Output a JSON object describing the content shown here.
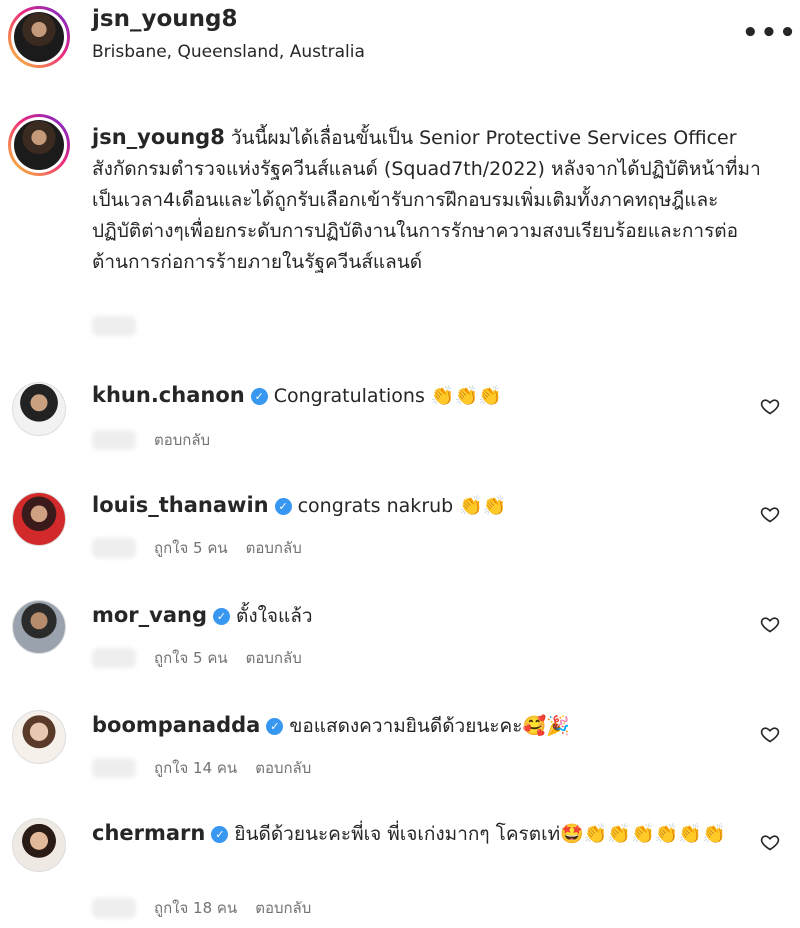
{
  "post_header": {
    "username": "jsn_young8",
    "location": "Brisbane, Queensland, Australia",
    "more_icon": "more-horizontal-icon"
  },
  "caption": {
    "username": "jsn_young8",
    "text": "วันนี้ผมได้เลื่อนขั้นเป็น Senior Protective Services Officer สังกัดกรมตำรวจแห่งรัฐควีนส์แลนด์ (Squad7th/2022) หลังจากได้ปฏิบัติหน้าที่มาเป็นเวลา4เดือนและได้ถูกรับเลือกเข้ารับการฝึกอบรมเพิ่มเติมทั้งภาคทฤษฎีและปฏิบัติต่างๆเพื่อยกระดับการปฏิบัติงานในการรักษาความสงบเรียบร้อยและการต่อต้านการก่อการร้ายภายในรัฐควีนส์แลนด์"
  },
  "comments": [
    {
      "username": "khun.chanon",
      "verified": true,
      "text": "Congratulations 👏👏👏",
      "likes": "",
      "reply": "ตอบกลับ"
    },
    {
      "username": "louis_thanawin",
      "verified": true,
      "text": "congrats nakrub 👏👏",
      "likes": "ถูกใจ 5 คน",
      "reply": "ตอบกลับ"
    },
    {
      "username": "mor_vang",
      "verified": true,
      "text": "ตั้งใจแล้ว",
      "likes": "ถูกใจ 5 คน",
      "reply": "ตอบกลับ"
    },
    {
      "username": "boompanadda",
      "verified": true,
      "text": "ขอแสดงความยินดีด้วยนะคะ🥰🎉",
      "likes": "ถูกใจ 14 คน",
      "reply": "ตอบกลับ"
    },
    {
      "username": "chermarn",
      "verified": true,
      "text": "ยินดีด้วยนะคะพี่เจ พี่เจเก่งมากๆ โครตเท่🤩👏👏👏👏👏👏",
      "likes": "ถูกใจ 18 คน",
      "reply": "ตอบกลับ"
    }
  ],
  "icons": {
    "verified": "verified-badge-icon",
    "heart": "heart-outline-icon"
  }
}
